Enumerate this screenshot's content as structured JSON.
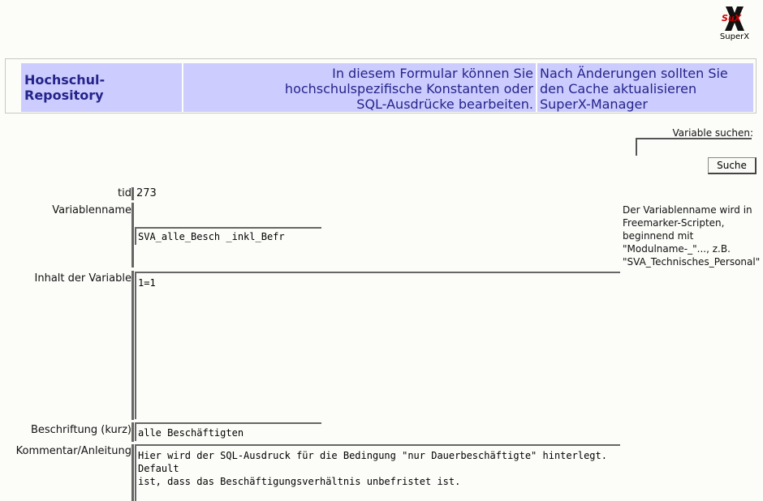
{
  "logo": {
    "text": "SuperX",
    "mark_text": "SuX"
  },
  "header": {
    "title": "Hochschul-Repository",
    "info_lines": [
      "In diesem Formular können Sie",
      "hochschulspezifische Konstanten oder",
      "SQL-Ausdrücke bearbeiten."
    ],
    "note_lines": [
      "Nach Änderungen sollten Sie",
      "den Cache aktualisieren"
    ],
    "manager_link": "SuperX-Manager"
  },
  "search": {
    "label": "Variable suchen:",
    "value": "",
    "button": "Suche"
  },
  "form": {
    "tid_label": "tid",
    "tid_value": "273",
    "name_label": "Variablenname",
    "name_value": "SVA_alle_Besch _inkl_Befr",
    "content_label": "Inhalt der Variable",
    "content_value": "1=1",
    "caption_label": "Beschriftung (kurz)",
    "caption_value": "alle Beschäftigten",
    "comment_label": "Kommentar/Anleitung",
    "comment_value": "Hier wird der SQL-Ausdruck für die Bedingung \"nur Dauerbeschäftigte\" hinterlegt. Default\nist, dass das Beschäftigungsverhältnis unbefristet ist."
  },
  "hint": {
    "lines": [
      "Der Variablenname wird in",
      "Freemarker-Scripten,",
      "beginnend mit",
      "\"Modulname-_\"..., z.B.",
      "\"SVA_Technisches_Personal\""
    ]
  },
  "colors": {
    "header_bg": "#ccccff",
    "header_text": "#24248a",
    "logo_red": "#cc0000"
  }
}
